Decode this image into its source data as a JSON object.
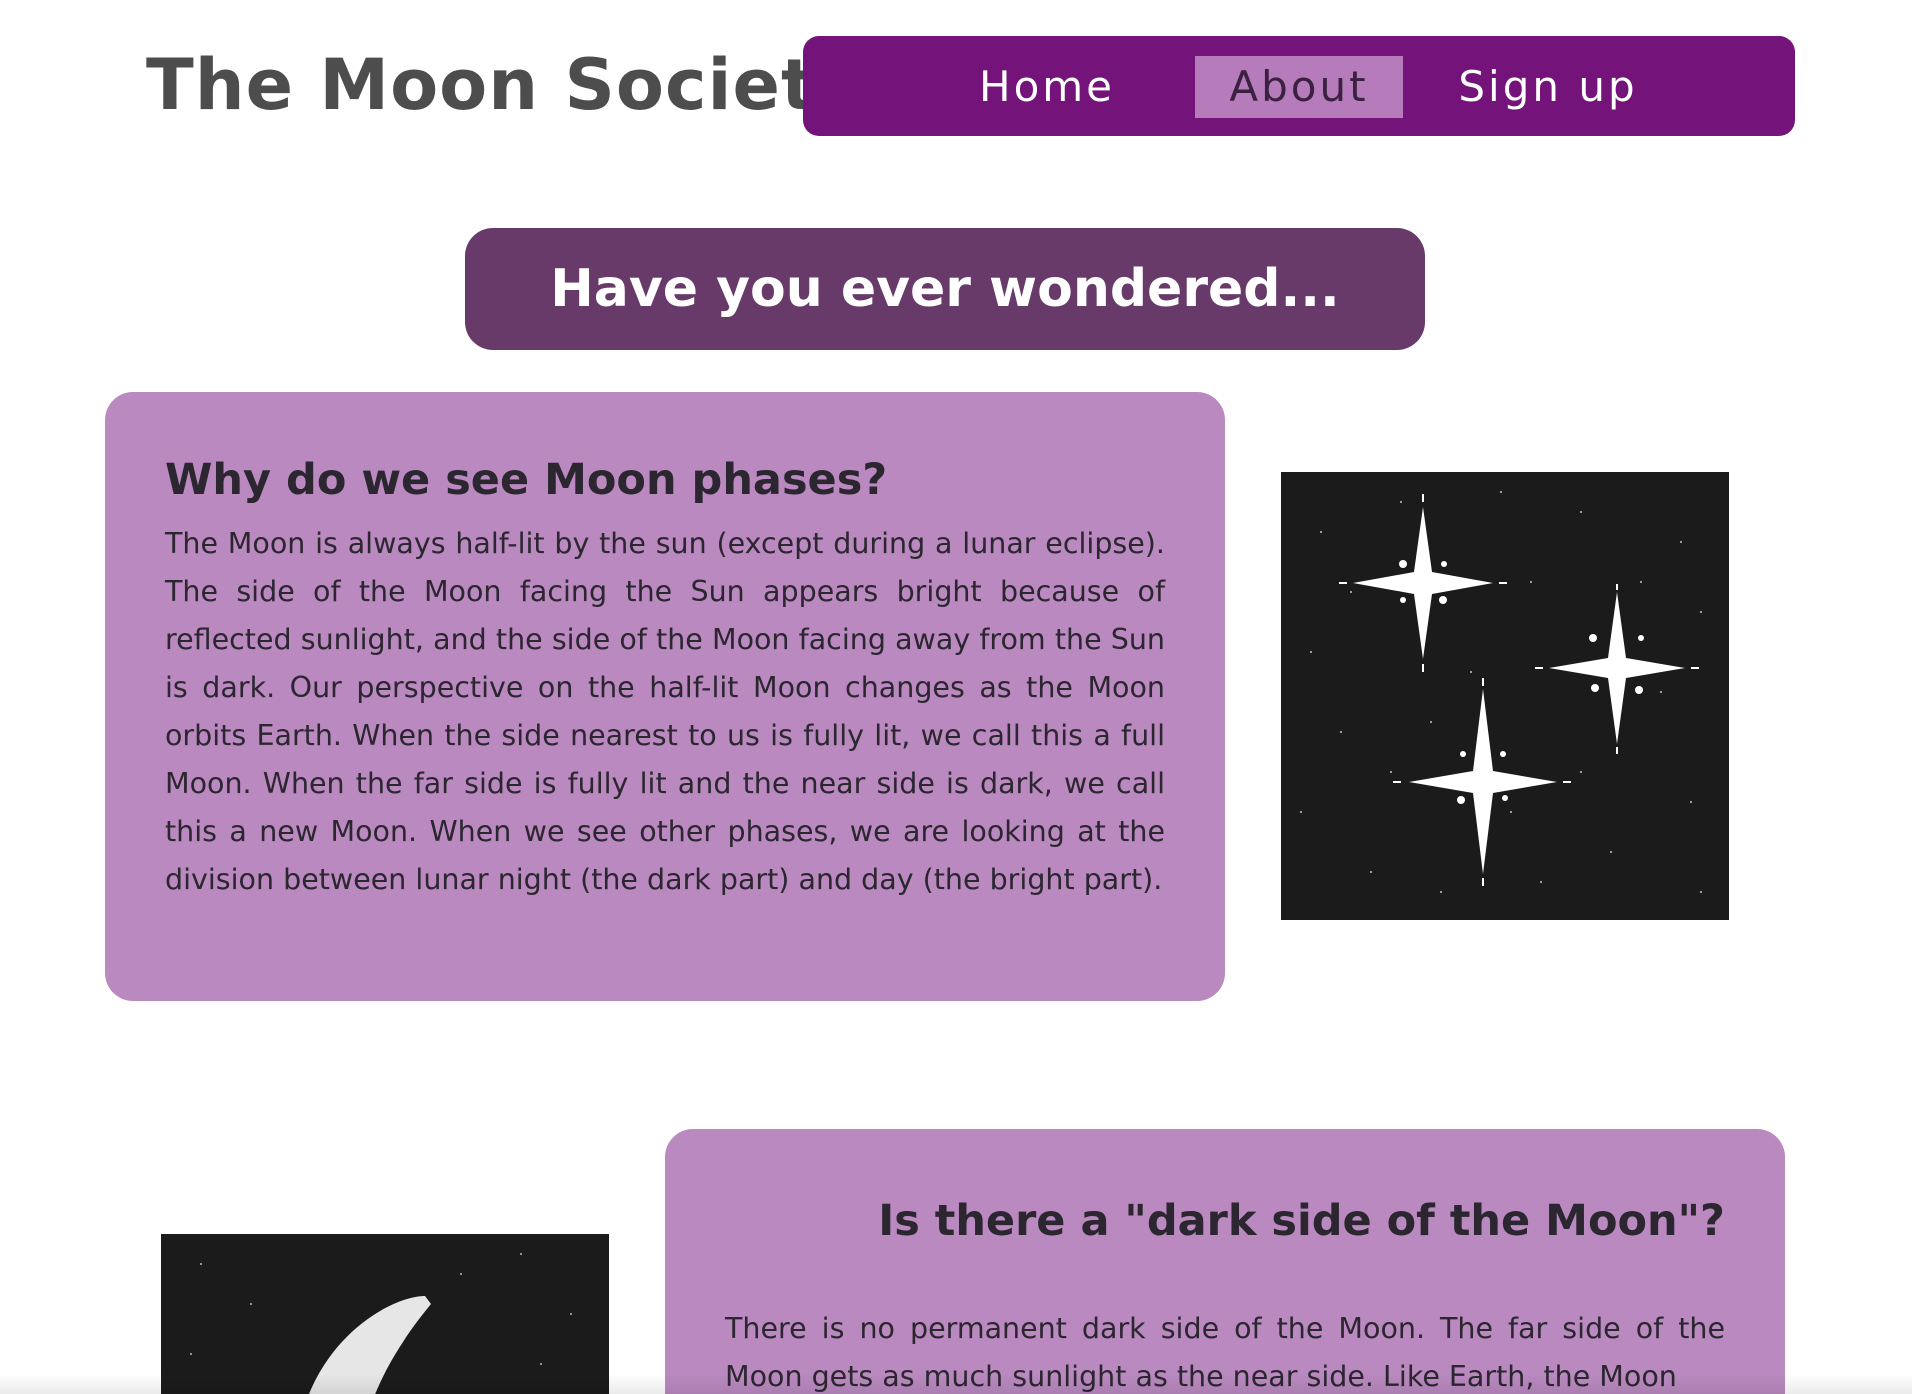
{
  "header": {
    "site_title": "The Moon Society"
  },
  "nav": {
    "items": [
      {
        "label": "Home",
        "active": false
      },
      {
        "label": "About",
        "active": true
      },
      {
        "label": "Sign up",
        "active": false
      }
    ]
  },
  "hero": {
    "title": "Have you ever wondered..."
  },
  "sections": [
    {
      "heading": "Why do we see Moon phases?",
      "body": "The Moon is always half-lit by the sun (except during a lunar eclipse). The side of the Moon facing the Sun appears bright because of reflected sunlight, and the side of the Moon facing away from the Sun is dark. Our perspective on the half-lit Moon changes as the Moon orbits Earth. When the side nearest to us is fully lit, we call this a full Moon. When the far side is fully lit and the near side is dark, we call this a new Moon. When we see other phases, we are looking at the division between lunar night (the dark part) and day (the bright part).",
      "image_icon": "sparkling-stars-illustration"
    },
    {
      "heading": "Is there a \"dark side of the Moon\"?",
      "body": "There is no permanent dark side of the Moon. The far side of the Moon gets as much sunlight as the near side. Like Earth, the Moon",
      "image_icon": "crescent-moon-illustration"
    }
  ],
  "colors": {
    "nav_background": "#74137a",
    "nav_active": "#b67bba",
    "hero_background": "#673a6a",
    "card_background": "#b989bf",
    "image_background": "#1b1b1b"
  }
}
